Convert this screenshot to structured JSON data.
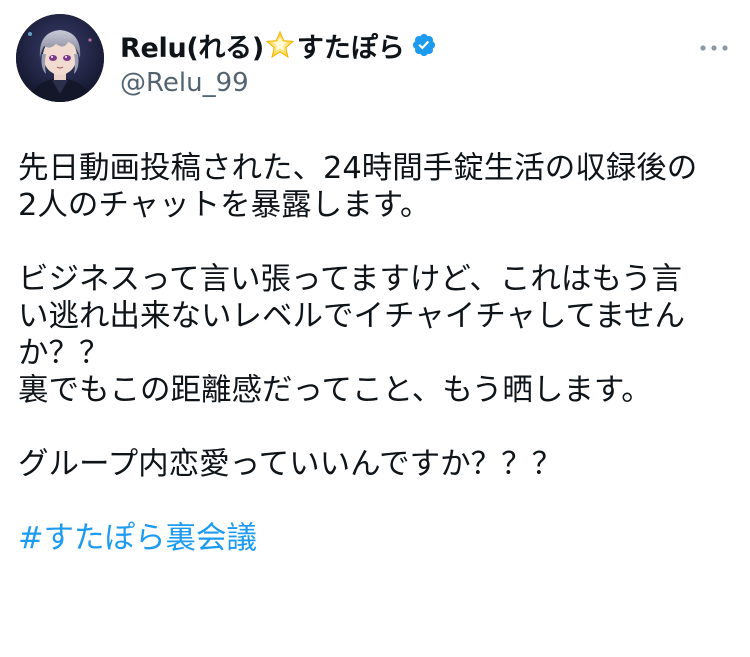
{
  "author": {
    "display_name": "Relu(れる)",
    "name_emoji": "star-icon",
    "name_suffix": "すたぽら",
    "verified": true,
    "handle": "@Relu_99"
  },
  "tweet": {
    "lines": [
      "先日動画投稿された、24時間手錠生活の収録後の",
      "2人のチャットを暴露します。",
      "",
      "ビジネスって言い張ってますけど、これはもう言",
      "い逃れ出来ないレベルでイチャイチャしてません",
      "か？？",
      "裏でもこの距離感だってこと、もう晒します。",
      "",
      "グループ内恋愛っていいんですか？？？",
      ""
    ],
    "hashtag": "#すたぽら裏会議"
  },
  "colors": {
    "text": "#0f1419",
    "secondary": "#536471",
    "accent": "#1d9bf0"
  },
  "icons": {
    "verified": "verified-badge-icon",
    "more": "more-horizontal-icon"
  }
}
